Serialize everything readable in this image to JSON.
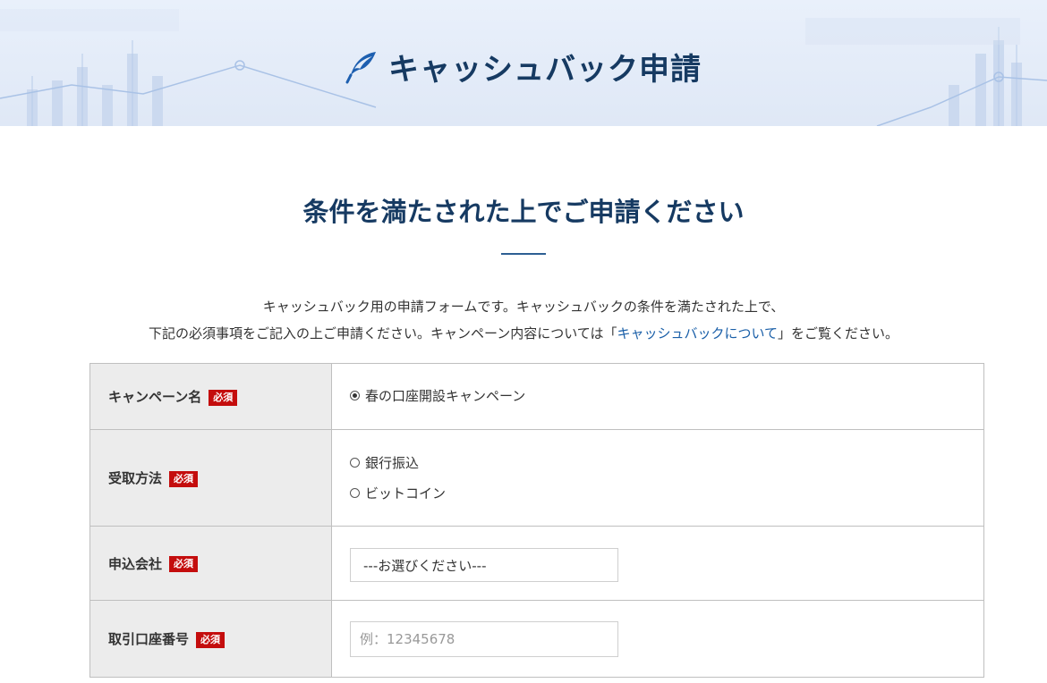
{
  "header": {
    "title": "キャッシュバック申請",
    "icon": "feather-pen-icon"
  },
  "main": {
    "subtitle": "条件を満たされた上でご申請ください",
    "intro_line1": "キャッシュバック用の申請フォームです。キャッシュバックの条件を満たされた上で、",
    "intro_line2_prefix": "下記の必須事項をご記入の上ご申請ください。キャンペーン内容については「",
    "intro_link": "キャッシュバックについて",
    "intro_line2_suffix": "」をご覧ください。"
  },
  "form": {
    "required_label": "必須",
    "campaign": {
      "label": "キャンペーン名",
      "option": "春の口座開設キャンペーン",
      "selected": true
    },
    "receive_method": {
      "label": "受取方法",
      "options": [
        "銀行振込",
        "ビットコイン"
      ]
    },
    "company": {
      "label": "申込会社",
      "select_value": "---お選びください---"
    },
    "account_number": {
      "label": "取引口座番号",
      "placeholder": "例：12345678"
    }
  },
  "colors": {
    "heading": "#163a62",
    "accent": "#2d5f93",
    "required_badge": "#c40d0d",
    "link": "#1a5fa8"
  }
}
